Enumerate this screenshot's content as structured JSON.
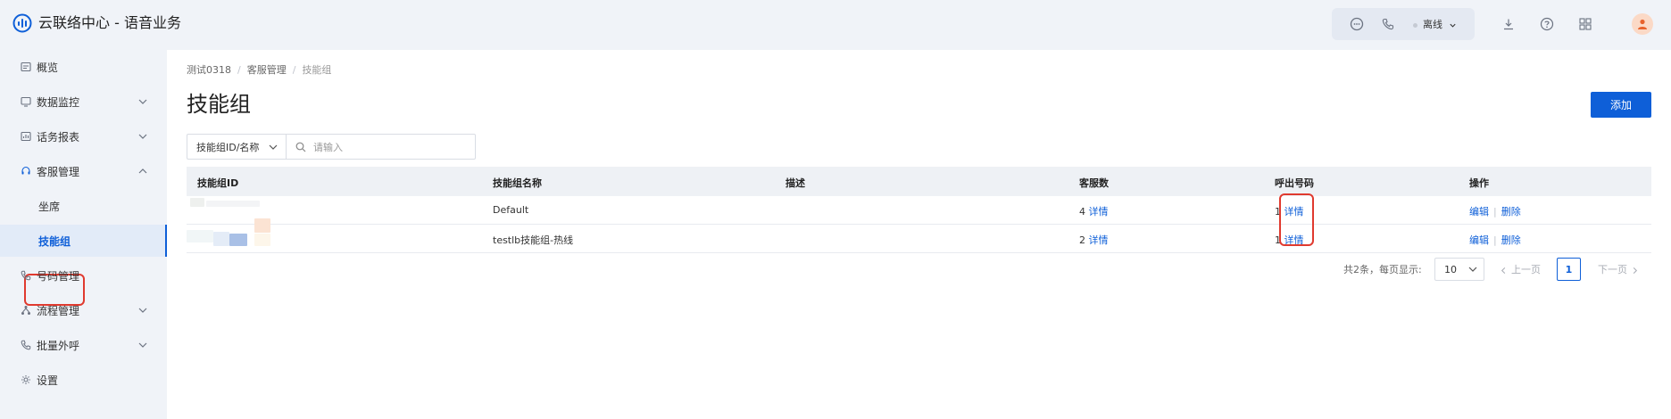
{
  "app": {
    "title": "云联络中心 - 语音业务",
    "status": "离线",
    "icons": [
      "chat-icon",
      "phone-icon",
      "download-icon",
      "help-icon",
      "apps-grid-icon"
    ]
  },
  "sidebar": {
    "items": [
      {
        "label": "概览",
        "icon": "overview-icon"
      },
      {
        "label": "数据监控",
        "icon": "monitor-icon"
      },
      {
        "label": "话务报表",
        "icon": "report-icon"
      },
      {
        "label": "客服管理",
        "icon": "headset-icon"
      },
      {
        "label": "坐席"
      },
      {
        "label": "技能组"
      },
      {
        "label": "号码管理",
        "icon": "phone-icon"
      },
      {
        "label": "流程管理",
        "icon": "flow-icon"
      },
      {
        "label": "批量外呼",
        "icon": "outbound-icon"
      },
      {
        "label": "设置",
        "icon": "gear-icon"
      }
    ]
  },
  "breadcrumb": [
    "测试0318",
    "客服管理",
    "技能组"
  ],
  "page": {
    "title": "技能组",
    "add_label": "添加"
  },
  "filter": {
    "select_value": "技能组ID/名称",
    "search_placeholder": "请输入"
  },
  "table": {
    "headers": [
      "技能组ID",
      "技能组名称",
      "描述",
      "客服数",
      "呼出号码",
      "操作"
    ],
    "rows": [
      {
        "id": "",
        "name": "Default",
        "desc": "",
        "agents": "4",
        "agents_link": "详情",
        "numbers": "1",
        "numbers_link": "详情",
        "edit": "编辑",
        "delete": "删除"
      },
      {
        "id": "",
        "name": "testlb技能组-热线",
        "desc": "",
        "agents": "2",
        "agents_link": "详情",
        "numbers": "1",
        "numbers_link": "详情",
        "edit": "编辑",
        "delete": "删除"
      }
    ]
  },
  "pagination": {
    "total": "共2条，每页显示:",
    "page_size": "10",
    "prev": "上一页",
    "current": "1",
    "next": "下一页"
  },
  "colors": {
    "accent": "#0e5fd8",
    "highlight_box": "#e03a2f"
  }
}
